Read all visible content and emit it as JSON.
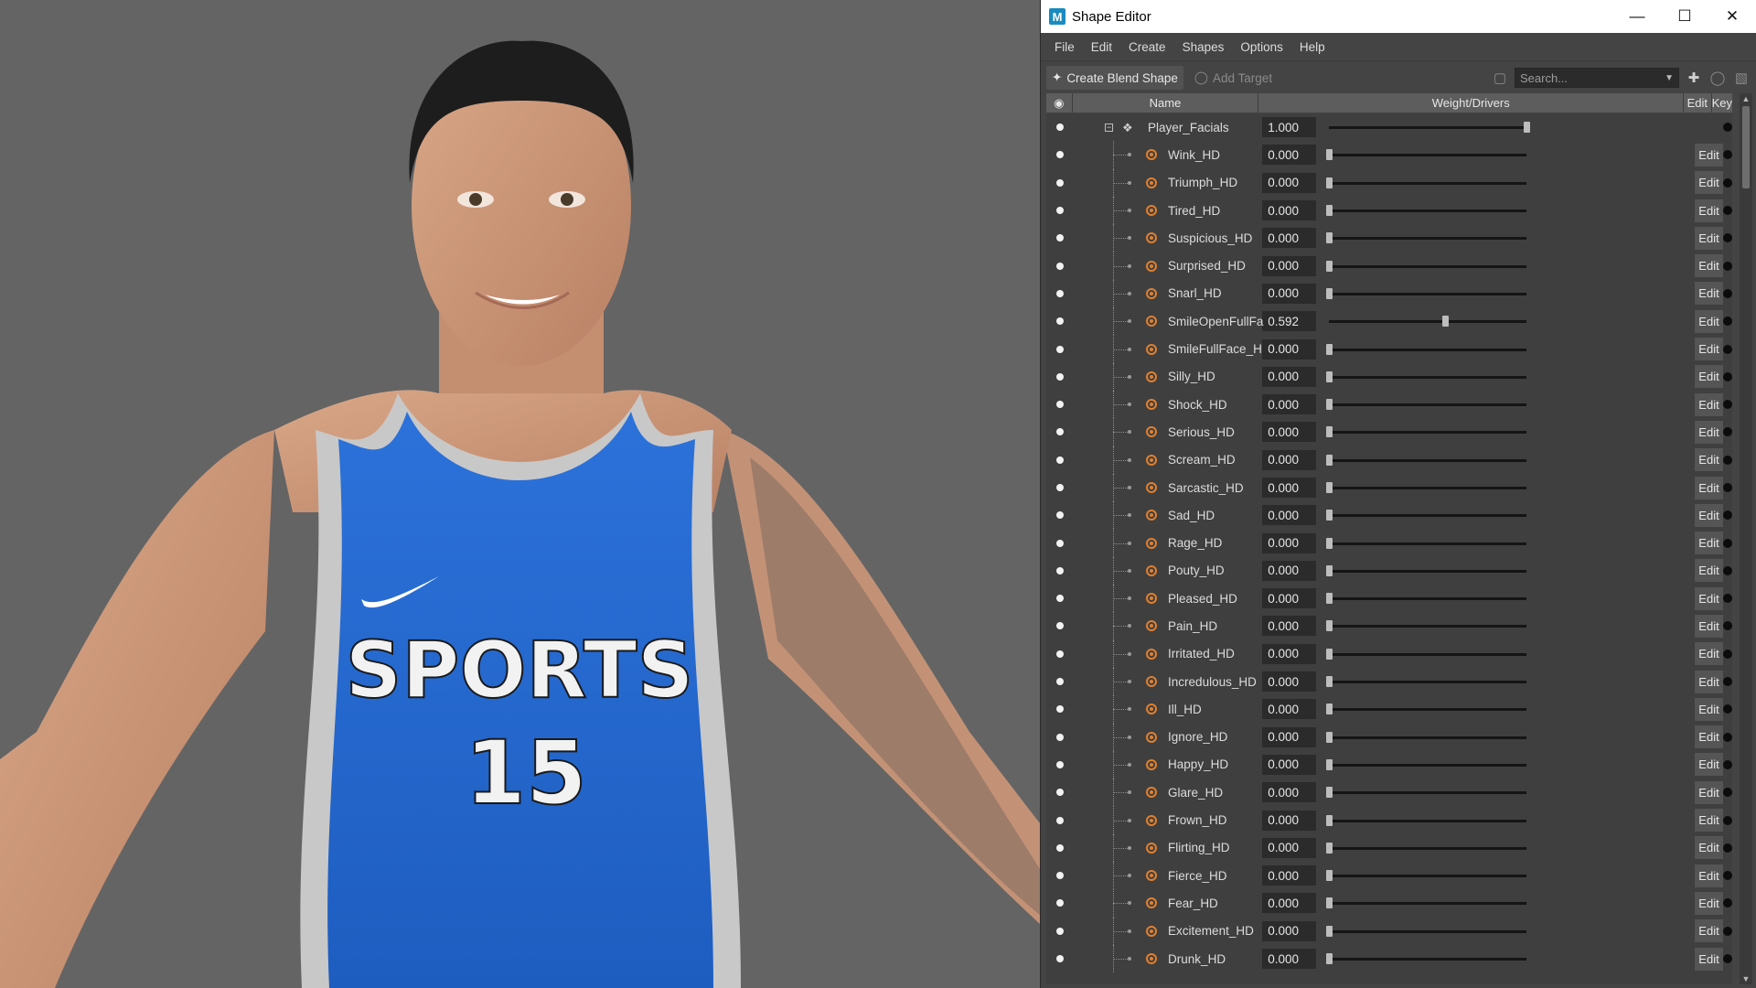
{
  "window": {
    "title": "Shape Editor",
    "app_icon": "M"
  },
  "menu": [
    "File",
    "Edit",
    "Create",
    "Shapes",
    "Options",
    "Help"
  ],
  "toolbar": {
    "create_blend_shape": "Create Blend Shape",
    "add_target": "Add Target",
    "search_placeholder": "Search..."
  },
  "columns": {
    "name": "Name",
    "weight": "Weight/Drivers",
    "edit": "Edit",
    "key": "Key"
  },
  "blend_shape": {
    "name": "Player_Facials",
    "weight": "1.000",
    "weight_value": 1.0
  },
  "edit_label": "Edit",
  "targets": [
    {
      "name": "Wink_HD",
      "weight": "0.000",
      "value": 0.0
    },
    {
      "name": "Triumph_HD",
      "weight": "0.000",
      "value": 0.0
    },
    {
      "name": "Tired_HD",
      "weight": "0.000",
      "value": 0.0
    },
    {
      "name": "Suspicious_HD",
      "weight": "0.000",
      "value": 0.0
    },
    {
      "name": "Surprised_HD",
      "weight": "0.000",
      "value": 0.0
    },
    {
      "name": "Snarl_HD",
      "weight": "0.000",
      "value": 0.0
    },
    {
      "name": "SmileOpenFullFa",
      "weight": "0.592",
      "value": 0.592
    },
    {
      "name": "SmileFullFace_H",
      "weight": "0.000",
      "value": 0.0
    },
    {
      "name": "Silly_HD",
      "weight": "0.000",
      "value": 0.0
    },
    {
      "name": "Shock_HD",
      "weight": "0.000",
      "value": 0.0
    },
    {
      "name": "Serious_HD",
      "weight": "0.000",
      "value": 0.0
    },
    {
      "name": "Scream_HD",
      "weight": "0.000",
      "value": 0.0
    },
    {
      "name": "Sarcastic_HD",
      "weight": "0.000",
      "value": 0.0
    },
    {
      "name": "Sad_HD",
      "weight": "0.000",
      "value": 0.0
    },
    {
      "name": "Rage_HD",
      "weight": "0.000",
      "value": 0.0
    },
    {
      "name": "Pouty_HD",
      "weight": "0.000",
      "value": 0.0
    },
    {
      "name": "Pleased_HD",
      "weight": "0.000",
      "value": 0.0
    },
    {
      "name": "Pain_HD",
      "weight": "0.000",
      "value": 0.0
    },
    {
      "name": "Irritated_HD",
      "weight": "0.000",
      "value": 0.0
    },
    {
      "name": "Incredulous_HD",
      "weight": "0.000",
      "value": 0.0
    },
    {
      "name": "Ill_HD",
      "weight": "0.000",
      "value": 0.0
    },
    {
      "name": "Ignore_HD",
      "weight": "0.000",
      "value": 0.0
    },
    {
      "name": "Happy_HD",
      "weight": "0.000",
      "value": 0.0
    },
    {
      "name": "Glare_HD",
      "weight": "0.000",
      "value": 0.0
    },
    {
      "name": "Frown_HD",
      "weight": "0.000",
      "value": 0.0
    },
    {
      "name": "Flirting_HD",
      "weight": "0.000",
      "value": 0.0
    },
    {
      "name": "Fierce_HD",
      "weight": "0.000",
      "value": 0.0
    },
    {
      "name": "Fear_HD",
      "weight": "0.000",
      "value": 0.0
    },
    {
      "name": "Excitement_HD",
      "weight": "0.000",
      "value": 0.0
    },
    {
      "name": "Drunk_HD",
      "weight": "0.000",
      "value": 0.0
    }
  ],
  "viewport": {
    "jersey_text": "SPORTS",
    "jersey_number": "15",
    "jersey_color": "#2a6fd6",
    "background_color": "#646464"
  }
}
